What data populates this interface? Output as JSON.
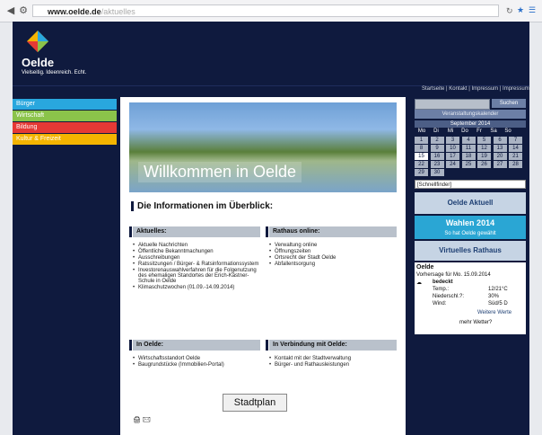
{
  "browser": {
    "url_host": "www.oelde.de",
    "url_path": "/aktuelles"
  },
  "site": {
    "logo_title": "Oelde",
    "slogan": "Vielseitig. Ideenreich. Echt.",
    "nav": [
      {
        "label": "Bürger",
        "color": "#29a7de"
      },
      {
        "label": "Wirtschaft",
        "color": "#8bc34a"
      },
      {
        "label": "Bildung",
        "color": "#e53935"
      },
      {
        "label": "Kultur & Freizeit",
        "color": "#f4b400"
      }
    ],
    "top_links": "Startseite | Kontakt | Impressum | Impressum",
    "search_button": "Suchen",
    "events_link": "Veranstaltungskalender",
    "hero_title": "Willkommen in Oelde",
    "info_heading": "Die Informationen im Überblick:",
    "sections": [
      {
        "header": "Aktuelles:",
        "items": [
          "Aktuelle Nachrichten",
          "Öffentliche Bekanntmachungen",
          "Ausschreibungen",
          "Ratssitzungen / Bürger- & Ratsinformationssystem",
          "Investorenauswahlverfahren für die Folgenutzung des ehemaligen Standortes der Erich-Kästner-Schule in Oelde",
          "Klimaschutzwochen (01.09.-14.09.2014)"
        ]
      },
      {
        "header": "Rathaus online:",
        "items": [
          "Verwaltung online",
          "Öffnungszeiten",
          "Ortsrecht der Stadt Oelde",
          "Abfallentsorgung"
        ]
      },
      {
        "header": "In Oelde:",
        "items": [
          "Wirtschaftsstandort Oelde",
          "Baugrundstücke (Immobilien-Portal)"
        ]
      },
      {
        "header": "In Verbindung mit Oelde:",
        "items": [
          "Kontakt mit der Stadtverwaltung",
          "Bürger- und Rathausleistungen"
        ]
      }
    ],
    "stadtplan": "Stadtplan",
    "calendar": {
      "month": "September 2014",
      "days": [
        "Mo",
        "Di",
        "Mi",
        "Do",
        "Fr",
        "Sa",
        "So"
      ],
      "weeks": [
        [
          "1",
          "2",
          "3",
          "4",
          "5",
          "6",
          "7"
        ],
        [
          "8",
          "9",
          "10",
          "11",
          "12",
          "13",
          "14"
        ],
        [
          "15",
          "16",
          "17",
          "18",
          "19",
          "20",
          "21"
        ],
        [
          "22",
          "23",
          "24",
          "25",
          "26",
          "27",
          "28"
        ],
        [
          "29",
          "30",
          "",
          "",
          "",
          "",
          ""
        ]
      ]
    },
    "schnellfinder": "[Schnellfinder]",
    "promos": {
      "aktuell": "Oelde Aktuell",
      "wahlen_title": "Wahlen 2014",
      "wahlen_sub": "So hat Oelde gewählt",
      "rathaus": "Virtuelles Rathaus"
    },
    "weather": {
      "city": "Oelde",
      "subtitle": "Vorhersage für Mo. 15.09.2014",
      "condition": "bedeckt",
      "temp_label": "Temp.:",
      "temp": "12/21°C",
      "rain_label": "Niederschl.?:",
      "rain": "30%",
      "wind_label": "Wind:",
      "wind": "Süd/5 D",
      "more": "Weitere Werte",
      "footer": "mehr Wetter?"
    }
  }
}
